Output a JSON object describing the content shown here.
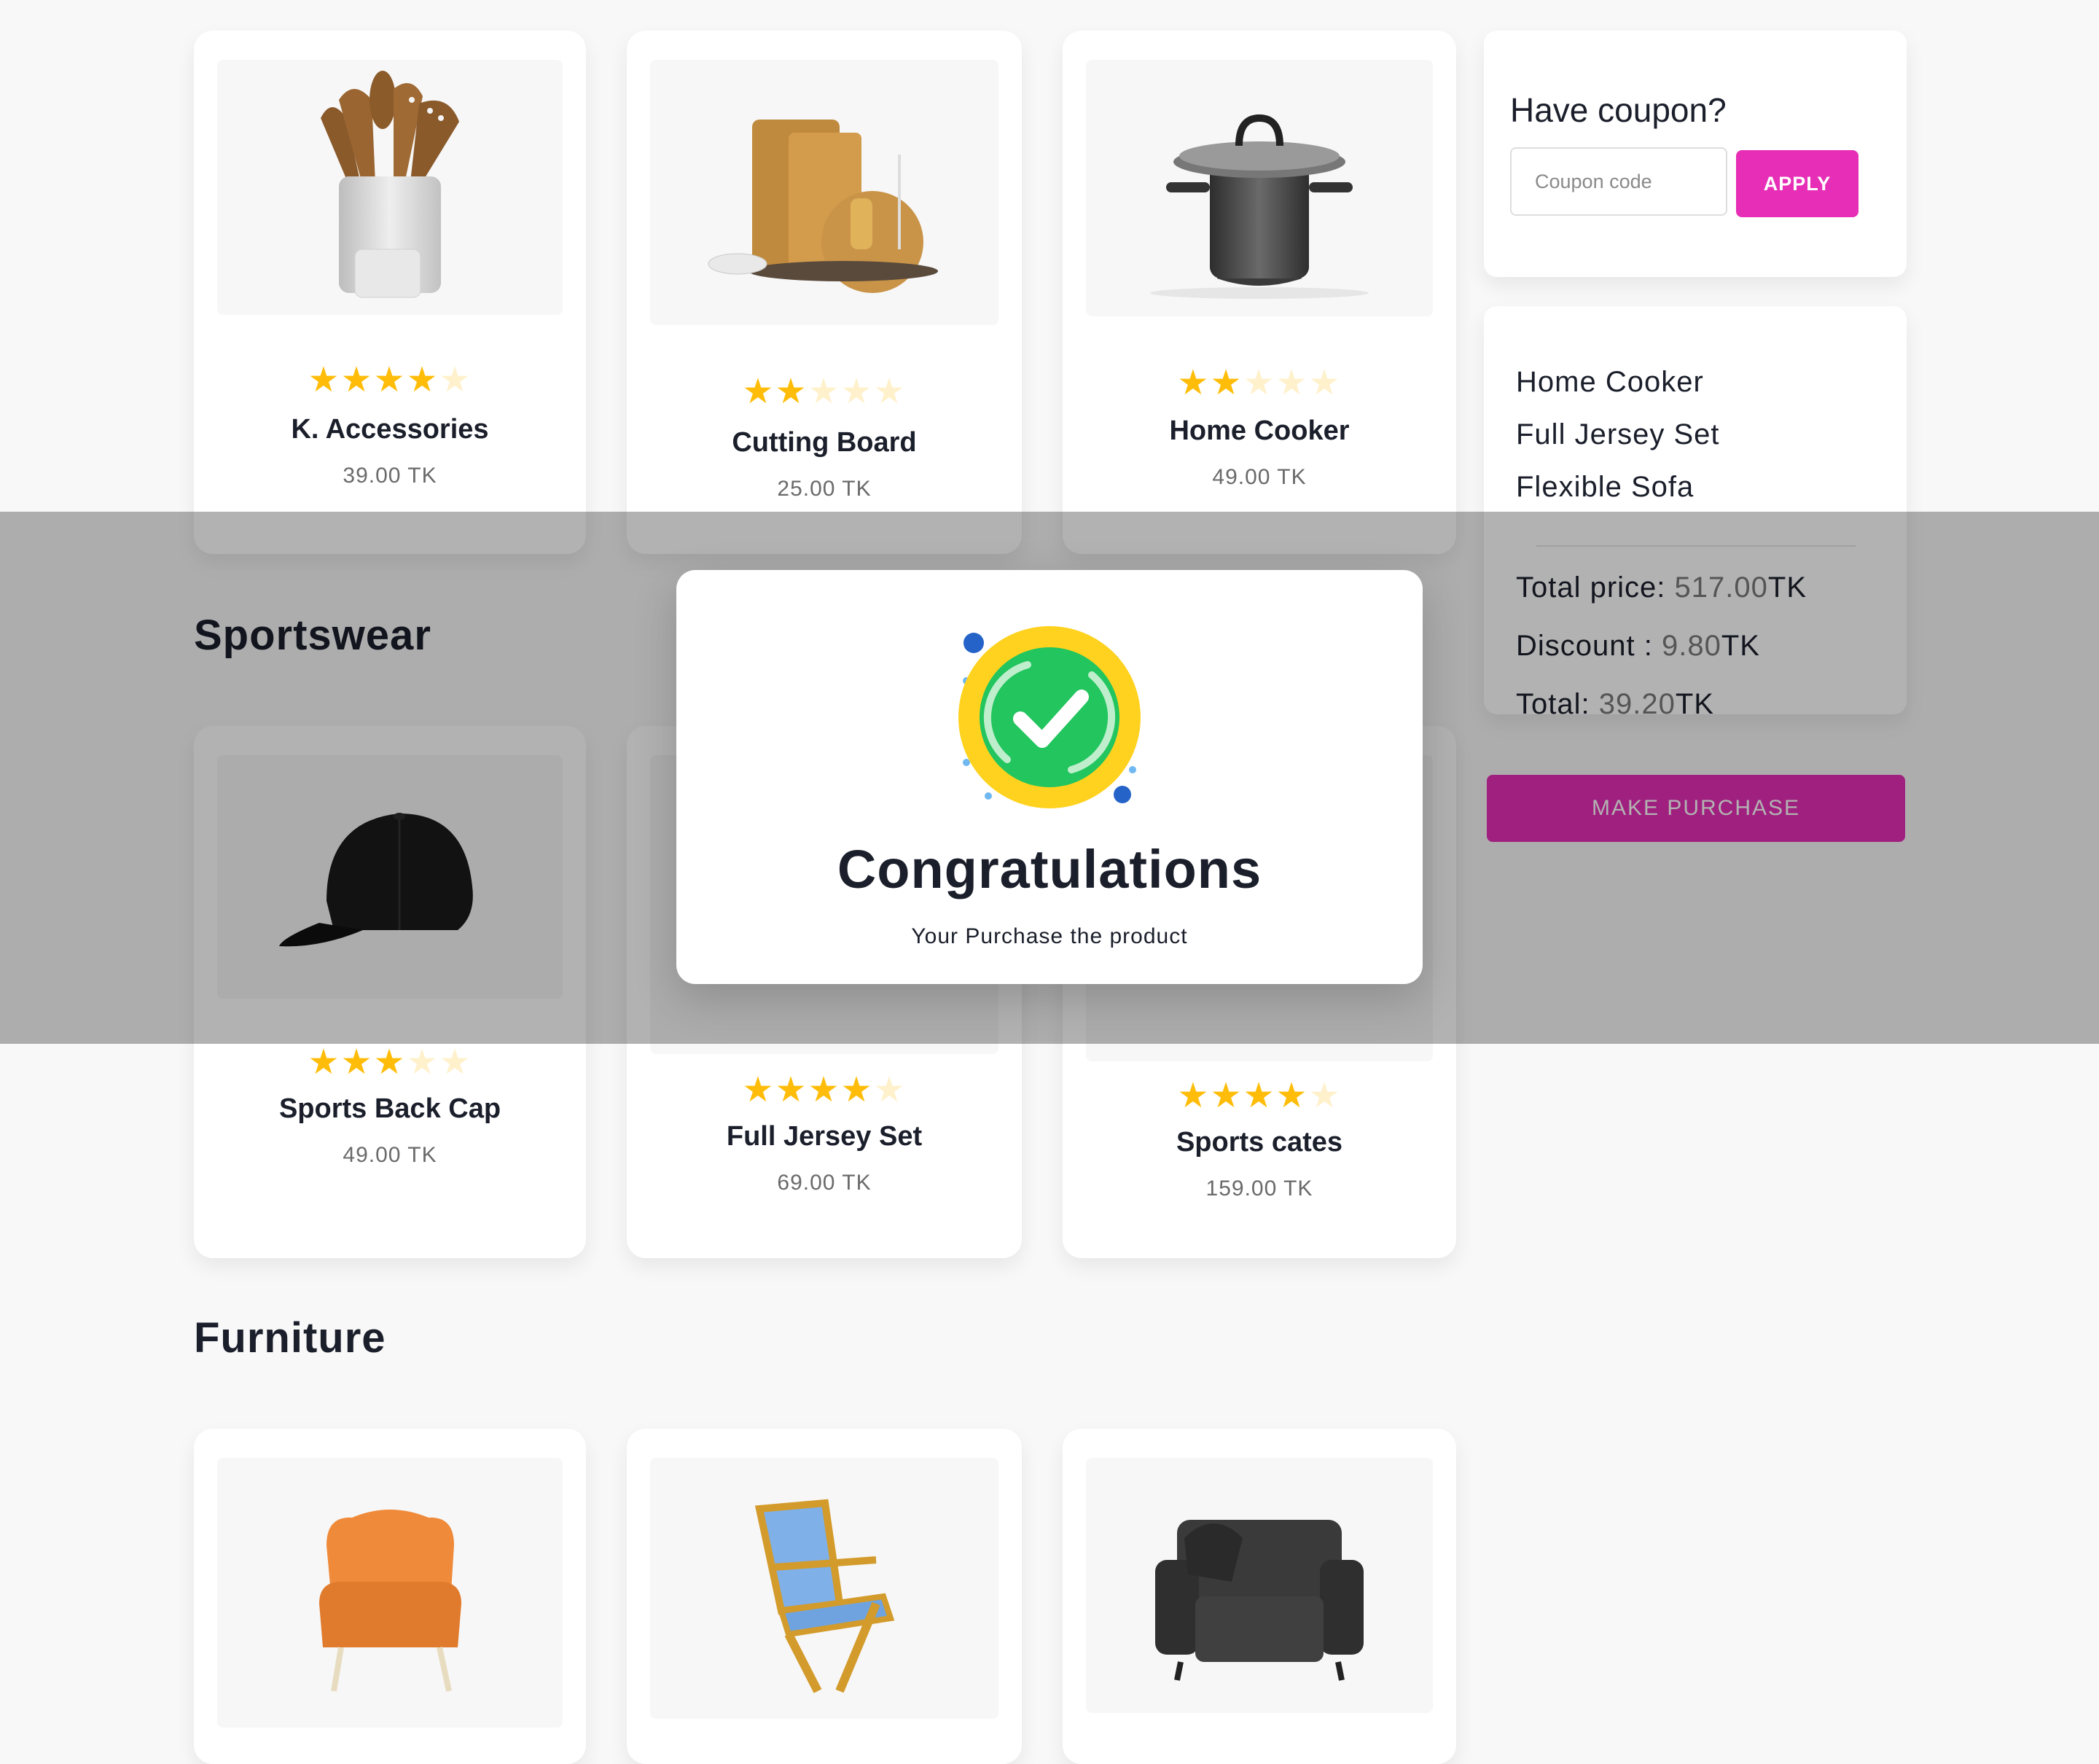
{
  "colors": {
    "accent": "#e62eb6",
    "star_on": "#ffbd0a",
    "star_off": "#fff1cc",
    "success": "#22c55e"
  },
  "sections": {
    "sportswear": "Sportswear",
    "furniture": "Furniture"
  },
  "products": {
    "row1": [
      {
        "name": "K. Accessories",
        "price": "39.00 TK",
        "rating": 4
      },
      {
        "name": "Cutting Board",
        "price": "25.00 TK",
        "rating": 2
      },
      {
        "name": "Home Cooker",
        "price": "49.00 TK",
        "rating": 2
      }
    ],
    "sportswear": [
      {
        "name": "Sports Back Cap",
        "price": "49.00 TK",
        "rating": 3
      },
      {
        "name": "Full Jersey Set",
        "price": "69.00 TK",
        "rating": 4
      },
      {
        "name": "Sports cates",
        "price": "159.00 TK",
        "rating": 4
      }
    ],
    "furniture_icons": [
      "orange-armchair-image",
      "folding-chair-image",
      "leather-armchair-image"
    ]
  },
  "coupon": {
    "title": "Have coupon?",
    "placeholder": "Coupon code",
    "apply_label": "APPLY"
  },
  "summary": {
    "items": [
      "Home Cooker",
      "Full Jersey Set",
      "Flexible Sofa"
    ],
    "total_price_label": "Total price:",
    "total_price_value": "517.00",
    "discount_label": "Discount :",
    "discount_value": "9.80",
    "total_label": "Total:",
    "total_value": "39.20",
    "currency": "TK",
    "purchase_label": "MAKE PURCHASE"
  },
  "modal": {
    "title": "Congratulations",
    "message": "Your Purchase the product"
  }
}
